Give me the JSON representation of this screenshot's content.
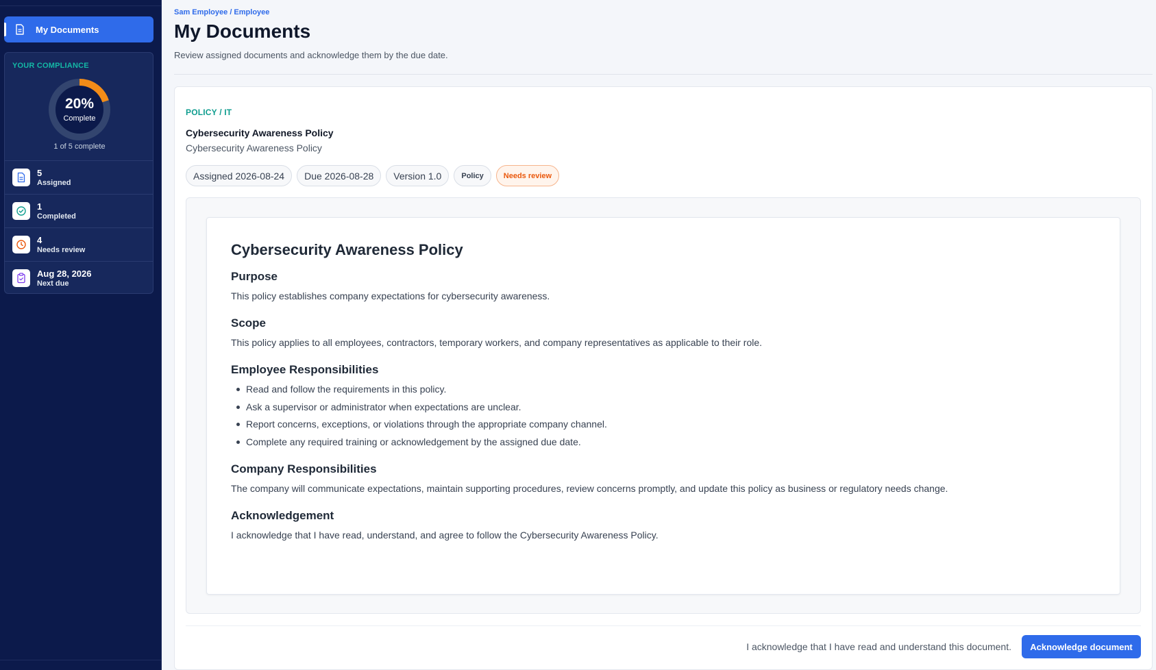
{
  "sidebar": {
    "nav_active_label": "My Documents",
    "compliance": {
      "title": "YOUR COMPLIANCE",
      "percent_label": "20%",
      "percent_value": 20,
      "percent_sub": "Complete",
      "progress_text": "1 of 5 complete",
      "ring_color": "#f28c18",
      "track_color": "#33456f"
    },
    "stats": [
      {
        "value": "5",
        "label": "Assigned",
        "icon": "document-icon",
        "color": "#2f6bea"
      },
      {
        "value": "1",
        "label": "Completed",
        "icon": "check-circle-icon",
        "color": "#0f9d8f"
      },
      {
        "value": "4",
        "label": "Needs review",
        "icon": "clock-icon",
        "color": "#ea580c"
      },
      {
        "value": "Aug 28, 2026",
        "label": "Next due",
        "icon": "clipboard-icon",
        "color": "#7c3aed"
      }
    ]
  },
  "header": {
    "breadcrumb": "Sam Employee / Employee",
    "title": "My Documents",
    "subtitle": "Review assigned documents and acknowledge them by the due date."
  },
  "document": {
    "category": "POLICY / IT",
    "title": "Cybersecurity Awareness Policy",
    "subtitle": "Cybersecurity Awareness Policy",
    "chips": {
      "assigned": "Assigned 2026-08-24",
      "due": "Due 2026-08-28",
      "version": "Version 1.0",
      "type": "Policy",
      "status": "Needs review"
    },
    "body": {
      "heading": "Cybersecurity Awareness Policy",
      "purpose_heading": "Purpose",
      "purpose_text": "This policy establishes company expectations for cybersecurity awareness.",
      "scope_heading": "Scope",
      "scope_text": "This policy applies to all employees, contractors, temporary workers, and company representatives as applicable to their role.",
      "employee_heading": "Employee Responsibilities",
      "employee_items": [
        "Read and follow the requirements in this policy.",
        "Ask a supervisor or administrator when expectations are unclear.",
        "Report concerns, exceptions, or violations through the appropriate company channel.",
        "Complete any required training or acknowledgement by the assigned due date."
      ],
      "company_heading": "Company Responsibilities",
      "company_text": "The company will communicate expectations, maintain supporting procedures, review concerns promptly, and update this policy as business or regulatory needs change.",
      "ack_heading": "Acknowledgement",
      "ack_text": "I acknowledge that I have read, understand, and agree to follow the Cybersecurity Awareness Policy."
    },
    "footer": {
      "ack_statement": "I acknowledge that I have read and understand this document.",
      "ack_button": "Acknowledge document"
    }
  }
}
